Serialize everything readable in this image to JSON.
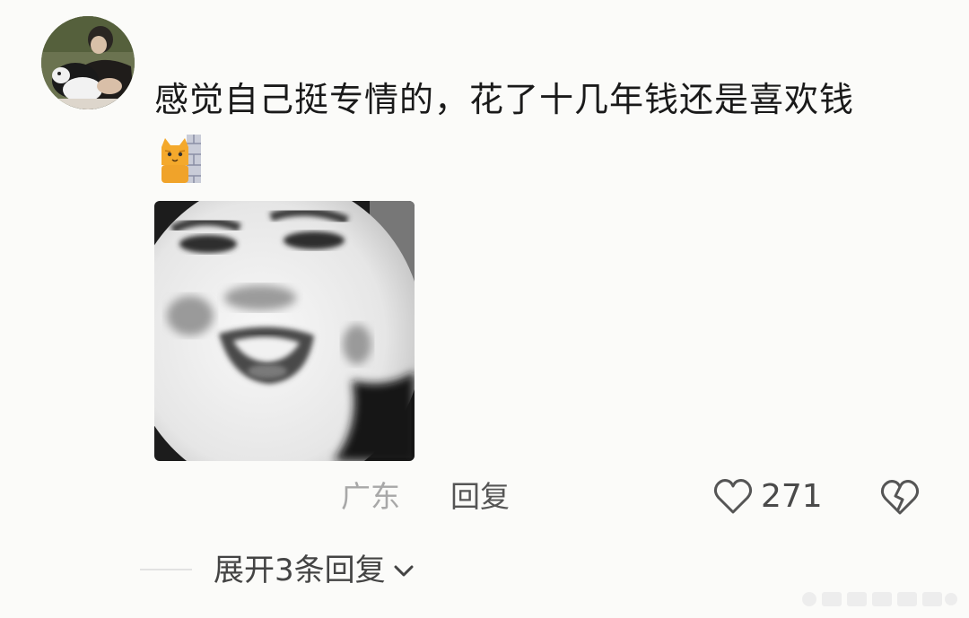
{
  "comment": {
    "avatar_icon": "user-avatar-photo",
    "text": "感觉自己挺专情的，花了十几年钱还是喜欢钱",
    "emoji_icon": "cat-peeking-emoji",
    "image_icon": "meme-face-sticker",
    "location": "广东",
    "reply_label": "回复",
    "like_icon": "heart-icon",
    "like_count": "271",
    "dislike_icon": "broken-heart-icon"
  },
  "replies": {
    "expand_label": "展开3条回复",
    "chevron_icon": "chevron-down-icon"
  },
  "colors": {
    "background": "#fbfbf9",
    "text_primary": "#1a1a1a",
    "text_secondary": "#a8a8a8",
    "icon": "#555555"
  }
}
